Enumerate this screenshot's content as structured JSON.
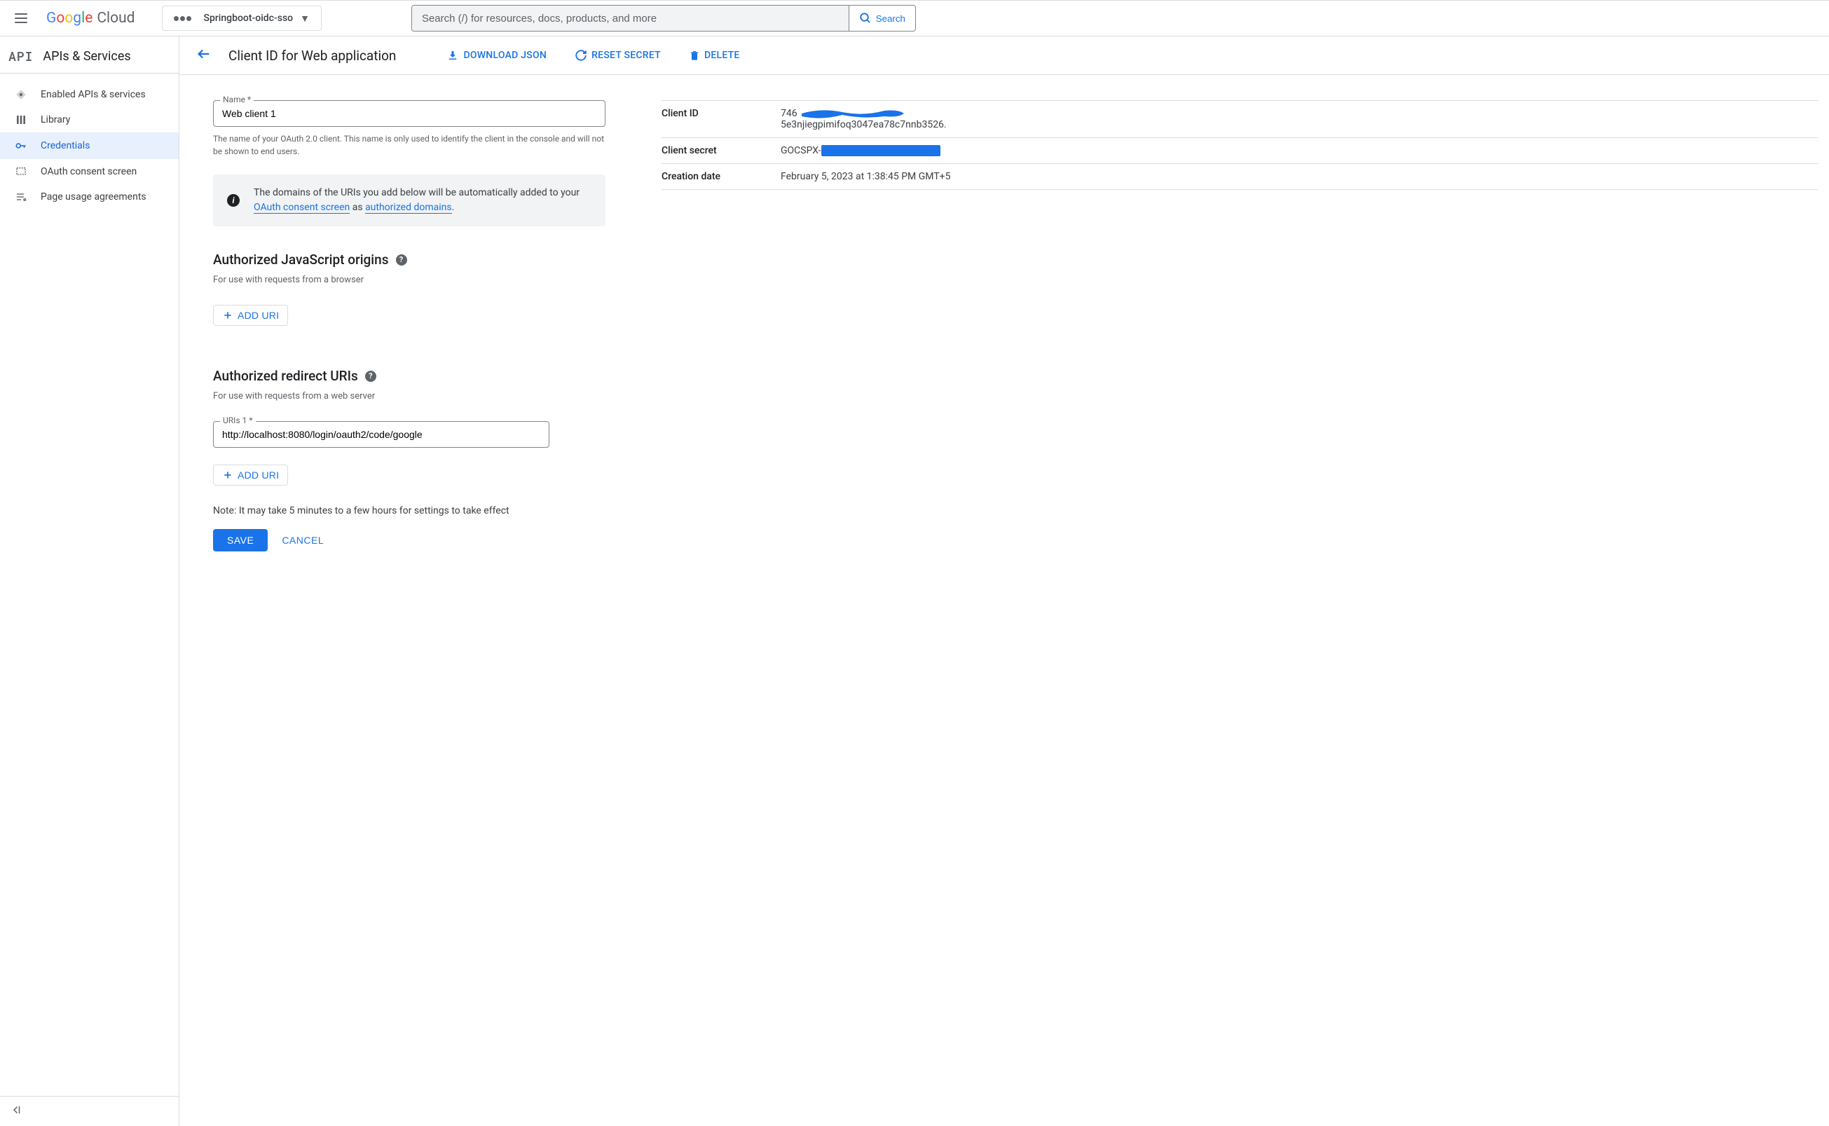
{
  "header": {
    "logo_google": "Google",
    "logo_cloud": " Cloud",
    "project_name": "Springboot-oidc-sso",
    "search_placeholder": "Search (/) for resources, docs, products, and more",
    "search_button": "Search"
  },
  "sidebar": {
    "api_badge": "API",
    "title": "APIs & Services",
    "items": [
      {
        "label": "Enabled APIs & services"
      },
      {
        "label": "Library"
      },
      {
        "label": "Credentials"
      },
      {
        "label": "OAuth consent screen"
      },
      {
        "label": "Page usage agreements"
      }
    ]
  },
  "page": {
    "title": "Client ID for Web application",
    "actions": {
      "download": "DOWNLOAD JSON",
      "reset": "RESET SECRET",
      "delete": "DELETE"
    }
  },
  "form": {
    "name_label": "Name *",
    "name_value": "Web client 1",
    "name_help": "The name of your OAuth 2.0 client. This name is only used to identify the client in the console and will not be shown to end users.",
    "banner_text_1": "The domains of the URIs you add below will be automatically added to your ",
    "banner_link_1": "OAuth consent screen",
    "banner_text_2": " as ",
    "banner_link_2": "authorized domains",
    "banner_text_3": ".",
    "js_origins_title": "Authorized JavaScript origins",
    "js_origins_desc": "For use with requests from a browser",
    "add_uri_label": "ADD URI",
    "redirect_uris_title": "Authorized redirect URIs",
    "redirect_uris_desc": "For use with requests from a web server",
    "uri1_label": "URIs 1 *",
    "uri1_value": "http://localhost:8080/login/oauth2/code/google",
    "note": "Note: It may take 5 minutes to a few hours for settings to take effect",
    "save": "SAVE",
    "cancel": "CANCEL"
  },
  "side": {
    "client_id_label": "Client ID",
    "client_id_prefix": "746",
    "client_id_line2": "5e3njiegpimifoq3047ea78c7nnb3526.",
    "client_secret_label": "Client secret",
    "client_secret_prefix": "GOCSPX-",
    "creation_label": "Creation date",
    "creation_value": "February 5, 2023 at 1:38:45 PM GMT+5"
  }
}
